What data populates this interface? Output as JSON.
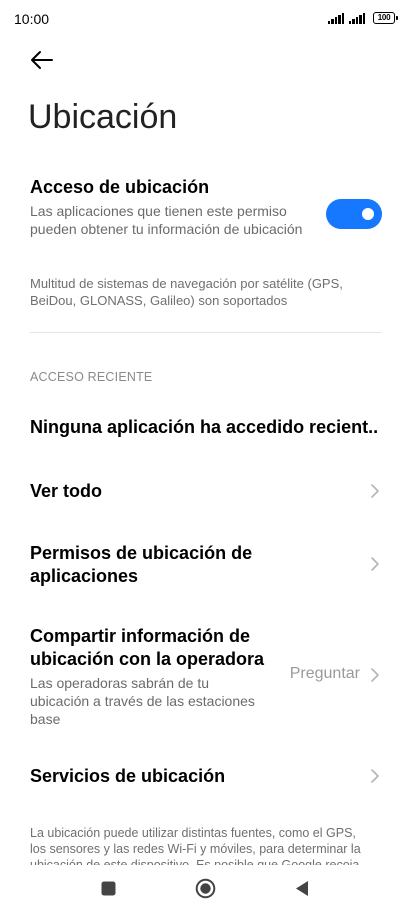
{
  "status_bar": {
    "time": "10:00",
    "battery": "100"
  },
  "header": {
    "title": "Ubicación"
  },
  "location_access": {
    "title": "Acceso de ubicación",
    "description": "Las aplicaciones que tienen este permiso pueden obtener tu información de ubicación",
    "enabled": true
  },
  "gnss_note": "Multitud de sistemas de navegación por satélite (GPS, BeiDou, GLONASS, Galileo) son soportados",
  "recent_access": {
    "header": "ACCESO RECIENTE",
    "empty_text": "Ninguna aplicación ha accedido recient.."
  },
  "rows": {
    "see_all": "Ver todo",
    "app_permissions": "Permisos de ubicación de aplicaciones",
    "carrier_sharing": {
      "title": "Compartir información de ubicación con la operadora",
      "subtitle": "Las operadoras sabrán de tu ubicación a través de las estaciones base",
      "value": "Preguntar"
    },
    "location_services": "Servicios de ubicación"
  },
  "footer_note": "La ubicación puede utilizar distintas fuentes, como el GPS, los sensores y las redes Wi-Fi y móviles, para determinar la ubicación de este dispositivo. Es posible que Google recoja",
  "colors": {
    "accent": "#1677ff",
    "text_secondary": "#6b6b6b"
  }
}
